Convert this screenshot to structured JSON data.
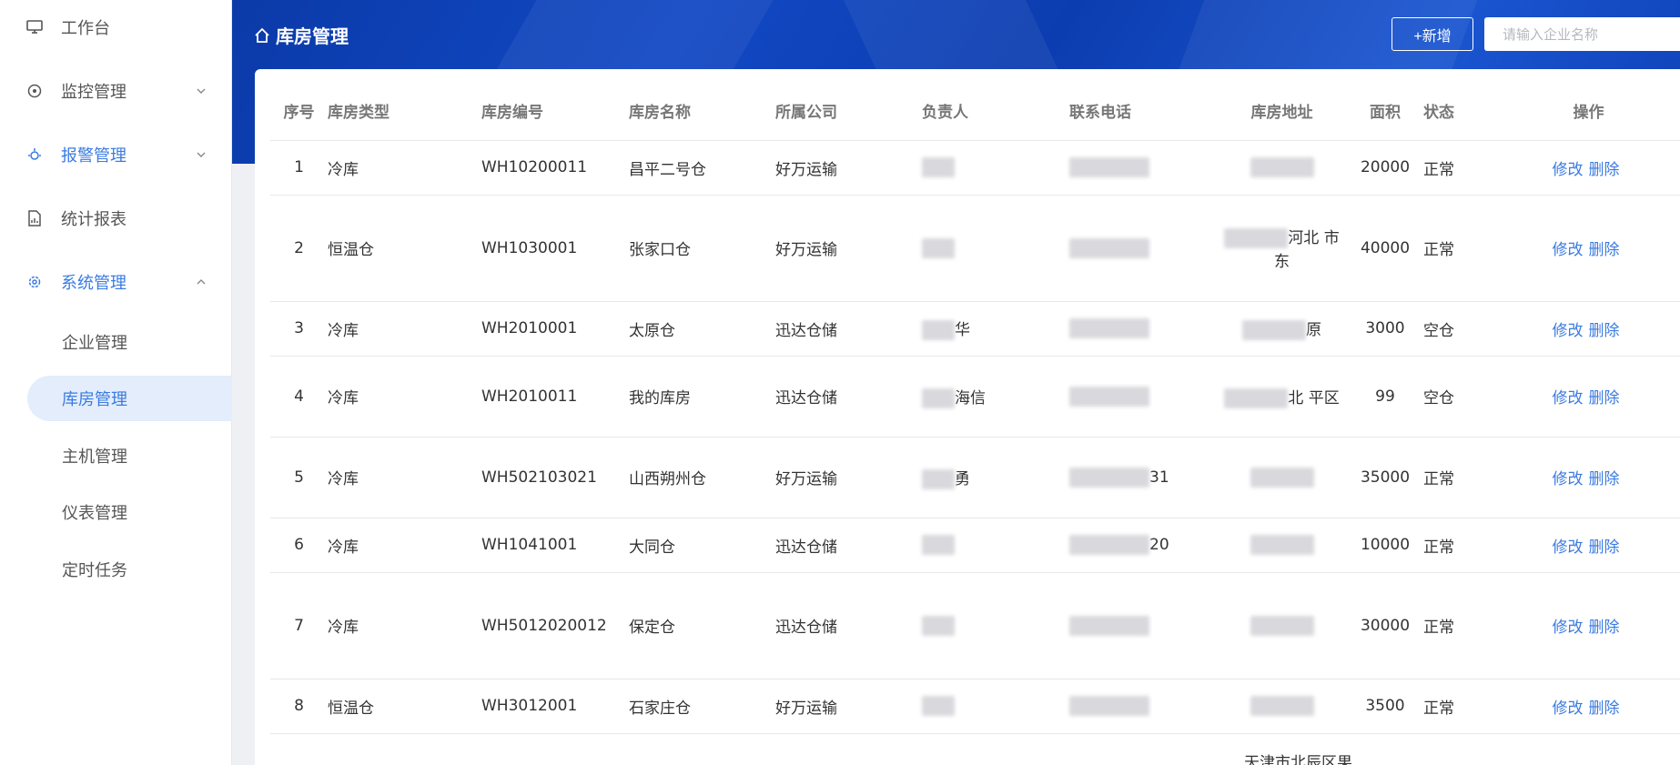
{
  "sidebar": {
    "items": [
      {
        "label": "工作台",
        "icon": "monitor-icon"
      },
      {
        "label": "监控管理",
        "icon": "monitor-target-icon"
      },
      {
        "label": "报警管理",
        "icon": "alarm-bug-icon"
      },
      {
        "label": "统计报表",
        "icon": "report-chart-icon"
      },
      {
        "label": "系统管理",
        "icon": "gear-icon"
      }
    ],
    "subitems": [
      {
        "label": "企业管理"
      },
      {
        "label": "库房管理"
      },
      {
        "label": "主机管理"
      },
      {
        "label": "仪表管理"
      },
      {
        "label": "定时任务"
      }
    ]
  },
  "header": {
    "title": "库房管理",
    "add_label": "+新增",
    "search_placeholder": "请输入企业名称"
  },
  "table": {
    "columns": [
      "序号",
      "库房类型",
      "库房编号",
      "库房名称",
      "所属公司",
      "负责人",
      "联系电话",
      "库房地址",
      "面积",
      "状态",
      "操作"
    ],
    "edit_label": "修改",
    "delete_label": "删除",
    "rows": [
      {
        "no": "1",
        "type": "冷库",
        "code": "WH10200011",
        "name": "昌平二号仓",
        "company": "好万运输",
        "owner": "",
        "phone": "",
        "address": "",
        "area": "20000",
        "status": "正常"
      },
      {
        "no": "2",
        "type": "恒温仓",
        "code": "WH1030001",
        "name": "张家口仓",
        "company": "好万运输",
        "owner": "",
        "phone": "",
        "address": "河北 市 东",
        "area": "40000",
        "status": "正常"
      },
      {
        "no": "3",
        "type": "冷库",
        "code": "WH2010001",
        "name": "太原仓",
        "company": "迅达仓储",
        "owner": "华",
        "phone": "",
        "address": "原",
        "area": "3000",
        "status": "空仓"
      },
      {
        "no": "4",
        "type": "冷库",
        "code": "WH2010011",
        "name": "我的库房",
        "company": "迅达仓储",
        "owner": "海信",
        "phone": "",
        "address": "北 平区",
        "area": "99",
        "status": "空仓"
      },
      {
        "no": "5",
        "type": "冷库",
        "code": "WH502103021",
        "name": "山西朔州仓",
        "company": "好万运输",
        "owner": "勇",
        "phone": "31",
        "address": "",
        "area": "35000",
        "status": "正常"
      },
      {
        "no": "6",
        "type": "冷库",
        "code": "WH1041001",
        "name": "大同仓",
        "company": "迅达仓储",
        "owner": "",
        "phone": "20",
        "address": "",
        "area": "10000",
        "status": "正常"
      },
      {
        "no": "7",
        "type": "冷库",
        "code": "WH5012020012",
        "name": "保定仓",
        "company": "迅达仓储",
        "owner": "",
        "phone": "",
        "address": "",
        "area": "30000",
        "status": "正常"
      },
      {
        "no": "8",
        "type": "恒温仓",
        "code": "WH3012001",
        "name": "石家庄仓",
        "company": "好万运输",
        "owner": "",
        "phone": "",
        "address": "",
        "area": "3500",
        "status": "正常"
      }
    ],
    "partial_address": "天津市北辰区果"
  },
  "colors": {
    "accent": "#3b7be0",
    "header_blue": "#0f42b8",
    "active_bg": "#e3edfb"
  }
}
